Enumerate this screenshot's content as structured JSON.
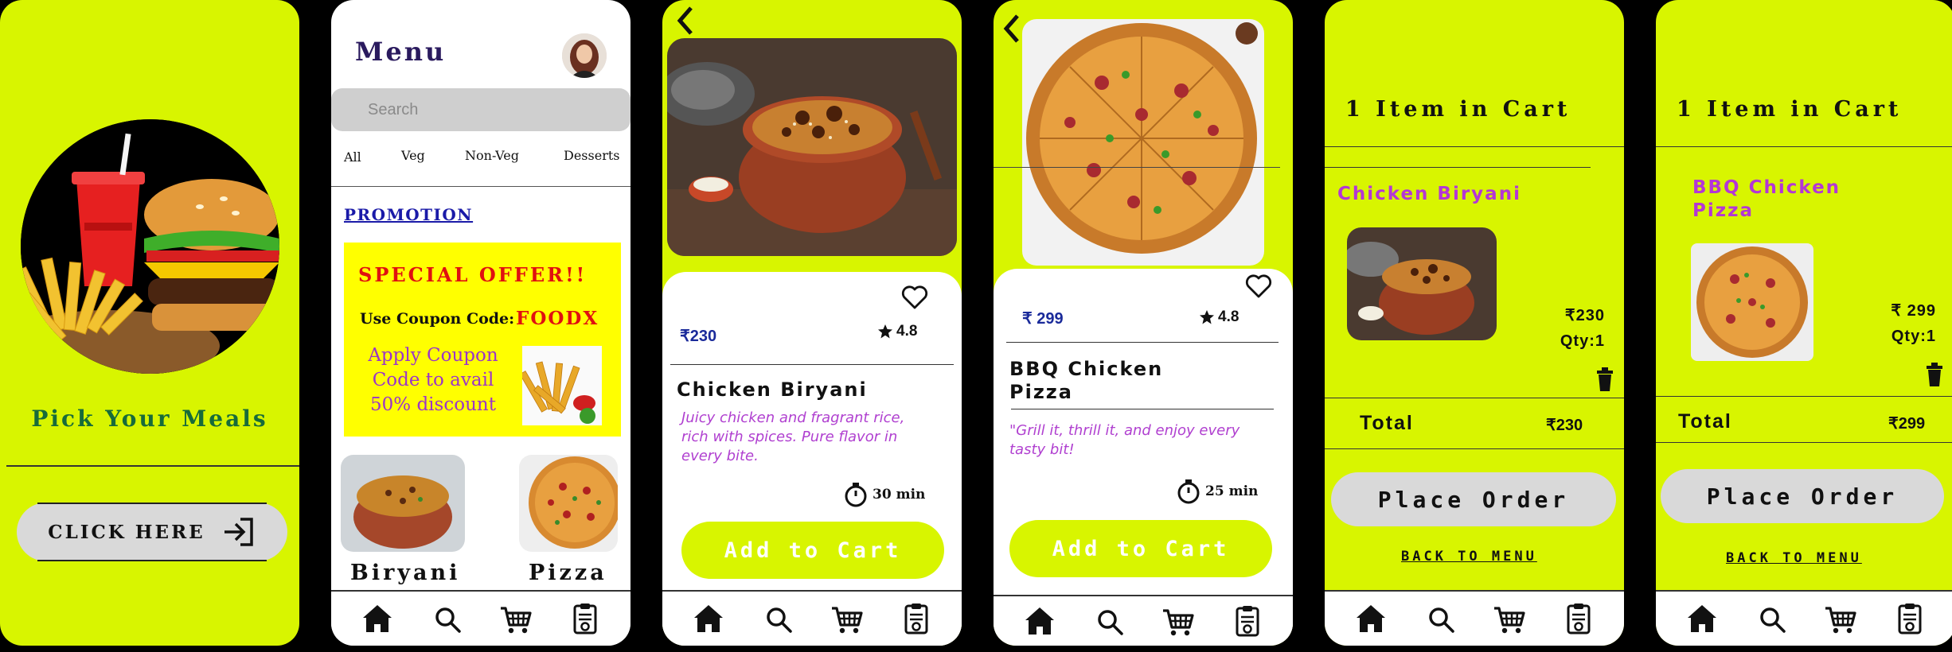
{
  "welcome": {
    "tagline": "Pick Your Meals",
    "cta_label": "CLICK HERE"
  },
  "menu": {
    "title": "Menu",
    "search_placeholder": "Search",
    "categories": [
      "All",
      "Veg",
      "Non-Veg",
      "Desserts"
    ],
    "promotion_link": "PROMOTION",
    "offer": {
      "title": "SPECIAL OFFER!!",
      "coupon_label": "Use Coupon Code:",
      "coupon_code": "FOODX",
      "apply_text": "Apply Coupon Code to avail 50% discount"
    },
    "dishes": [
      "Biryani",
      "Pizza"
    ]
  },
  "biryani_detail": {
    "price": "₹230",
    "rating": "4.8",
    "name": "Chicken Biryani",
    "description": "Juicy chicken and fragrant rice, rich with spices.   Pure flavor in every bite.",
    "time": "30 min",
    "add_label": "Add to Cart"
  },
  "pizza_detail": {
    "price": "₹ 299",
    "rating": "4.8",
    "name": "BBQ Chicken Pizza",
    "description": "\"Grill it, thrill it, and enjoy every tasty bit!",
    "time": "25 min",
    "add_label": "Add to Cart"
  },
  "cart_biryani": {
    "title": "1 Item in Cart",
    "item_name": "Chicken Biryani",
    "price": "₹230",
    "qty": "Qty:1",
    "total_label": "Total",
    "total_value": "₹230",
    "order_label": "Place Order",
    "back_label": "BACK TO MENU"
  },
  "cart_pizza": {
    "title": "1 Item in Cart",
    "item_name": "BBQ Chicken Pizza",
    "price": "₹ 299",
    "qty": "Qty:1",
    "total_label": "Total",
    "total_value": "₹299",
    "order_label": "Place Order",
    "back_label": "BACK TO MENU"
  },
  "colors": {
    "lime": "#d8f500",
    "price_blue": "#1a2a9a",
    "desc_purple": "#b040d0",
    "offer_red": "#e01010"
  },
  "icons": [
    "home-icon",
    "search-icon",
    "cart-icon",
    "orders-icon",
    "heart-icon",
    "star-icon",
    "timer-icon",
    "trash-icon",
    "back-chevron-icon",
    "login-arrow-icon"
  ]
}
